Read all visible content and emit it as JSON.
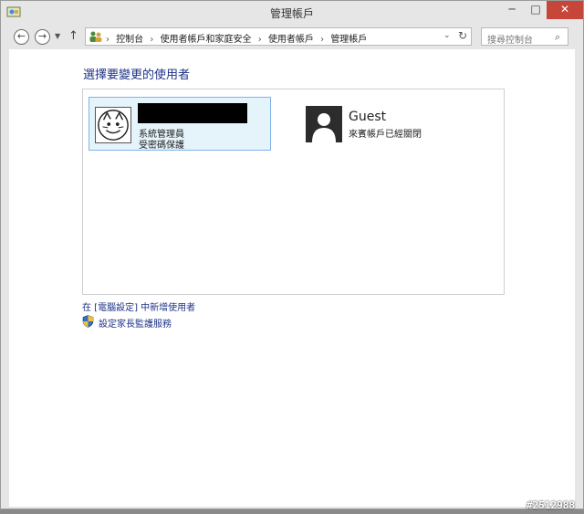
{
  "window": {
    "title": "管理帳戶",
    "minimize": "─",
    "maximize": "□",
    "close": "✕"
  },
  "nav": {
    "back": "←",
    "forward": "→",
    "recent": "▼",
    "up": "↑"
  },
  "address": {
    "crumbs": [
      "控制台",
      "使用者帳戶和家庭安全",
      "使用者帳戶",
      "管理帳戶"
    ],
    "separator": "›",
    "dropdown": "⌄",
    "refresh": "↻"
  },
  "search": {
    "placeholder": "搜尋控制台",
    "icon": "⌕"
  },
  "main": {
    "heading": "選擇要變更的使用者",
    "users": [
      {
        "name": "",
        "role": "系統管理員",
        "status": "受密碼保護"
      },
      {
        "name": "Guest",
        "status": "來賓帳戶已經關閉"
      }
    ],
    "add_user_link": "在 [電腦設定] 中新增使用者",
    "parental_link": "設定家長監護服務"
  },
  "watermark": "#2512988",
  "colors": {
    "link": "#1e3287",
    "selected_bg": "#e5f3fb",
    "selected_border": "#7eb4ea",
    "close_button": "#c7463a"
  }
}
